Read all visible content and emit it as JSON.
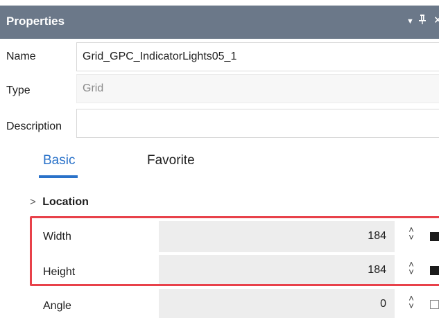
{
  "panel": {
    "title": "Properties",
    "header_buttons": {
      "dropdown_icon": "chevron-down-icon",
      "pin_icon": "pin-icon",
      "close_icon": "close-icon",
      "dropdown_glyph": "▼",
      "pin_glyph": "ᵾ",
      "close_glyph": "✕"
    }
  },
  "fields": {
    "name": {
      "label": "Name",
      "value": "Grid_GPC_IndicatorLights05_1"
    },
    "type": {
      "label": "Type",
      "value": "Grid"
    },
    "description": {
      "label": "Description",
      "value": ""
    }
  },
  "tabs": [
    {
      "label": "Basic",
      "active": true
    },
    {
      "label": "Favorite",
      "active": false
    }
  ],
  "location_group": {
    "label": "Location",
    "chevron_glyph": ">",
    "properties": [
      {
        "label": "Width",
        "value": "184",
        "swatch": "filled"
      },
      {
        "label": "Height",
        "value": "184",
        "swatch": "filled"
      },
      {
        "label": "Angle",
        "value": "0",
        "swatch": "empty"
      }
    ]
  },
  "spinner": {
    "up_glyph": "˄",
    "down_glyph": "˅"
  },
  "colors": {
    "titlebar": "#6b7889",
    "accent": "#2a72c9",
    "highlight": "#e8414a",
    "value_background": "#ededed"
  }
}
